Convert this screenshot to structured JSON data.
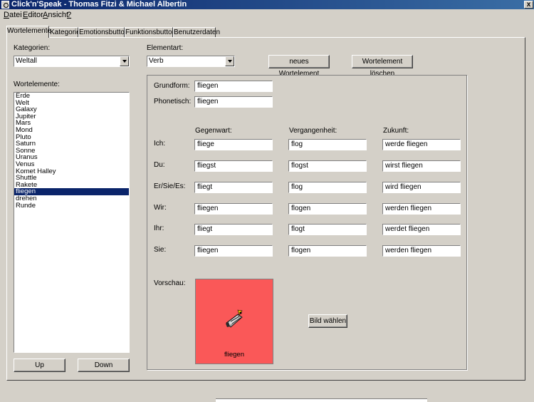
{
  "window": {
    "title": "Click'n'Speak - Thomas Fitzi & Michael Albertin",
    "close": "x"
  },
  "menu": [
    {
      "u": "D",
      "rest": "atei"
    },
    {
      "u": "E",
      "rest": "ditor"
    },
    {
      "u": "A",
      "rest": "nsicht"
    },
    {
      "u": "?",
      "rest": ""
    }
  ],
  "tabs": [
    "Wortelemente",
    "Kategorie",
    "Emotionsbuttons",
    "Funktionsbuttons",
    "Benutzerdaten"
  ],
  "left": {
    "categories_label": "Kategorien:",
    "category_selected": "Weltall",
    "elements_label": "Wortelemente:",
    "elements": [
      "Erde",
      "Welt",
      "Galaxy",
      "Jupiter",
      "Mars",
      "Mond",
      "Pluto",
      "Saturn",
      "Sonne",
      "Uranus",
      "Venus",
      "Komet Halley",
      "Shuttle",
      "Rakete",
      "fliegen",
      "drehen",
      "Runde"
    ],
    "selected_index": 14,
    "up": "Up",
    "down": "Down"
  },
  "element_type": {
    "label": "Elementart:",
    "selected": "Verb"
  },
  "actions": {
    "new": "neues Wortelement",
    "delete": "Wortelement löschen"
  },
  "forms": {
    "grundform_label": "Grundform:",
    "grundform": "fliegen",
    "phonetisch_label": "Phonetisch:",
    "phonetisch": "fliegen"
  },
  "conjugation": {
    "headers": [
      "Gegenwart:",
      "Vergangenheit:",
      "Zukunft:"
    ],
    "rows": [
      {
        "pronoun": "Ich:",
        "values": [
          "fliege",
          "flog",
          "werde fliegen"
        ]
      },
      {
        "pronoun": "Du:",
        "values": [
          "fliegst",
          "flogst",
          "wirst fliegen"
        ]
      },
      {
        "pronoun": "Er/Sie/Es:",
        "values": [
          "fliegt",
          "flog",
          "wird fliegen"
        ]
      },
      {
        "pronoun": "Wir:",
        "values": [
          "fliegen",
          "flogen",
          "werden fliegen"
        ]
      },
      {
        "pronoun": "Ihr:",
        "values": [
          "fliegt",
          "flogt",
          "werdet fliegen"
        ]
      },
      {
        "pronoun": "Sie:",
        "values": [
          "fliegen",
          "flogen",
          "werden fliegen"
        ]
      }
    ]
  },
  "preview": {
    "label": "Vorschau:",
    "caption": "fliegen",
    "icon": "space-shuttle-icon",
    "color": "#fa5858",
    "choose_image": "Bild wählen"
  }
}
